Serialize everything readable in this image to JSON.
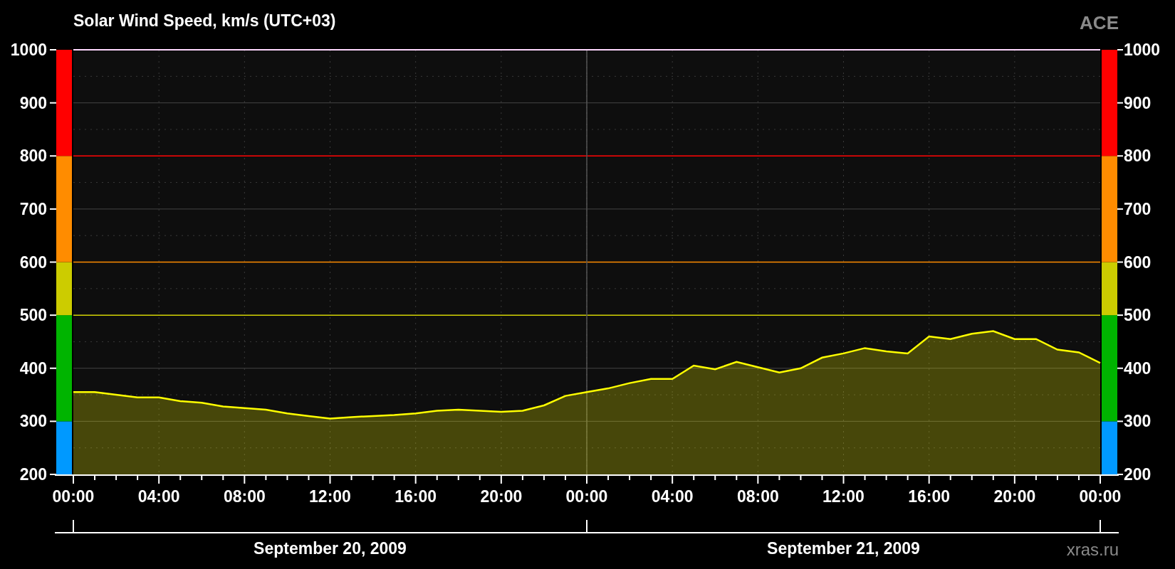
{
  "header": {
    "source": "ACE"
  },
  "chart": {
    "chart_data": {
      "type": "area",
      "title": "Solar Wind Speed, km/s (UTC+03)",
      "x": [
        "2009-09-20T00:00",
        "2009-09-20T01:00",
        "2009-09-20T02:00",
        "2009-09-20T03:00",
        "2009-09-20T04:00",
        "2009-09-20T05:00",
        "2009-09-20T06:00",
        "2009-09-20T07:00",
        "2009-09-20T08:00",
        "2009-09-20T09:00",
        "2009-09-20T10:00",
        "2009-09-20T11:00",
        "2009-09-20T12:00",
        "2009-09-20T13:00",
        "2009-09-20T14:00",
        "2009-09-20T15:00",
        "2009-09-20T16:00",
        "2009-09-20T17:00",
        "2009-09-20T18:00",
        "2009-09-20T19:00",
        "2009-09-20T20:00",
        "2009-09-20T21:00",
        "2009-09-20T22:00",
        "2009-09-20T23:00",
        "2009-09-21T00:00",
        "2009-09-21T01:00",
        "2009-09-21T02:00",
        "2009-09-21T03:00",
        "2009-09-21T04:00",
        "2009-09-21T05:00",
        "2009-09-21T06:00",
        "2009-09-21T07:00",
        "2009-09-21T08:00",
        "2009-09-21T09:00",
        "2009-09-21T10:00",
        "2009-09-21T11:00",
        "2009-09-21T12:00",
        "2009-09-21T13:00",
        "2009-09-21T14:00",
        "2009-09-21T15:00",
        "2009-09-21T16:00",
        "2009-09-21T17:00",
        "2009-09-21T18:00",
        "2009-09-21T19:00",
        "2009-09-21T20:00",
        "2009-09-21T21:00",
        "2009-09-21T22:00",
        "2009-09-21T23:00",
        "2009-09-22T00:00"
      ],
      "series": [
        {
          "color": "#ffff00",
          "values": [
            355,
            355,
            350,
            345,
            345,
            338,
            335,
            328,
            325,
            322,
            315,
            310,
            305,
            308,
            310,
            312,
            315,
            320,
            322,
            320,
            318,
            320,
            330,
            348,
            355,
            362,
            372,
            380,
            380,
            405,
            398,
            412,
            402,
            392,
            400,
            420,
            428,
            438,
            432,
            428,
            460,
            455,
            465,
            470,
            455,
            455,
            435,
            430,
            410
          ]
        }
      ],
      "xlim": [
        "2009-09-20T00:00",
        "2009-09-22T00:00"
      ],
      "ylim": [
        200,
        1000
      ],
      "xticks": [
        {
          "value": "2009-09-20T00:00",
          "label": "00:00"
        },
        {
          "value": "2009-09-20T04:00",
          "label": "04:00"
        },
        {
          "value": "2009-09-20T08:00",
          "label": "08:00"
        },
        {
          "value": "2009-09-20T12:00",
          "label": "12:00"
        },
        {
          "value": "2009-09-20T16:00",
          "label": "16:00"
        },
        {
          "value": "2009-09-20T20:00",
          "label": "20:00"
        },
        {
          "value": "2009-09-21T00:00",
          "label": "00:00"
        },
        {
          "value": "2009-09-21T04:00",
          "label": "04:00"
        },
        {
          "value": "2009-09-21T08:00",
          "label": "08:00"
        },
        {
          "value": "2009-09-21T12:00",
          "label": "12:00"
        },
        {
          "value": "2009-09-21T16:00",
          "label": "16:00"
        },
        {
          "value": "2009-09-21T20:00",
          "label": "20:00"
        },
        {
          "value": "2009-09-22T00:00",
          "label": "00:00"
        }
      ],
      "yticks": [
        1000,
        900,
        800,
        700,
        600,
        500,
        400,
        300,
        200
      ],
      "grid": true,
      "ref_lines": [
        {
          "axis": "y",
          "value": 500,
          "color": "#cccc00"
        },
        {
          "axis": "y",
          "value": 600,
          "color": "#ff8c00"
        },
        {
          "axis": "y",
          "value": 800,
          "color": "#ff0000"
        },
        {
          "axis": "x",
          "value": "2009-09-21T00:00",
          "color": "#555555"
        }
      ]
    },
    "speed_scale": [
      {
        "color": "#0099ff"
      },
      {
        "color": "#00b400"
      },
      {
        "color": "#cccc00"
      },
      {
        "color": "#ff8c00"
      },
      {
        "color": "#ff0000"
      }
    ],
    "left_axis_labels": [
      "1000",
      "900",
      "800",
      "700",
      "600",
      "500",
      "400",
      "300",
      "200"
    ],
    "right_axis_labels": [
      "1000",
      "900",
      "800",
      "700",
      "600",
      "500",
      "400",
      "300",
      "200"
    ],
    "day_labels": [
      {
        "text": "September 20, 2009"
      },
      {
        "text": "September 21, 2009"
      }
    ],
    "credit": "xras.ru"
  }
}
